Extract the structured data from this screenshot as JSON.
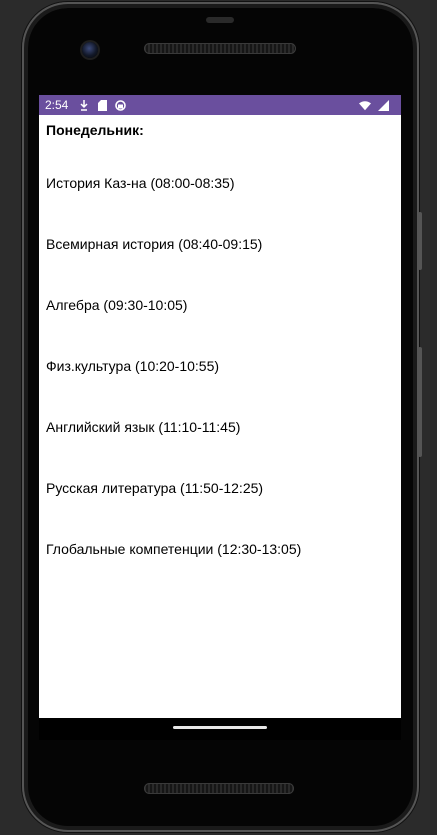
{
  "status_bar": {
    "time": "2:54",
    "icons": [
      "download-arrow-icon",
      "sd-card-icon",
      "sync-circle-icon",
      "wifi-icon",
      "signal-icon"
    ],
    "color": "#6a4f9e"
  },
  "schedule": {
    "day_title": "Понедельник:",
    "lessons": [
      "История Каз-на (08:00-08:35)",
      "Всемирная история (08:40-09:15)",
      "Алгебра (09:30-10:05)",
      "Физ.культура (10:20-10:55)",
      "Английский язык (11:10-11:45)",
      "Русская литература (11:50-12:25)",
      "Глобальные компетенции (12:30-13:05)"
    ]
  }
}
